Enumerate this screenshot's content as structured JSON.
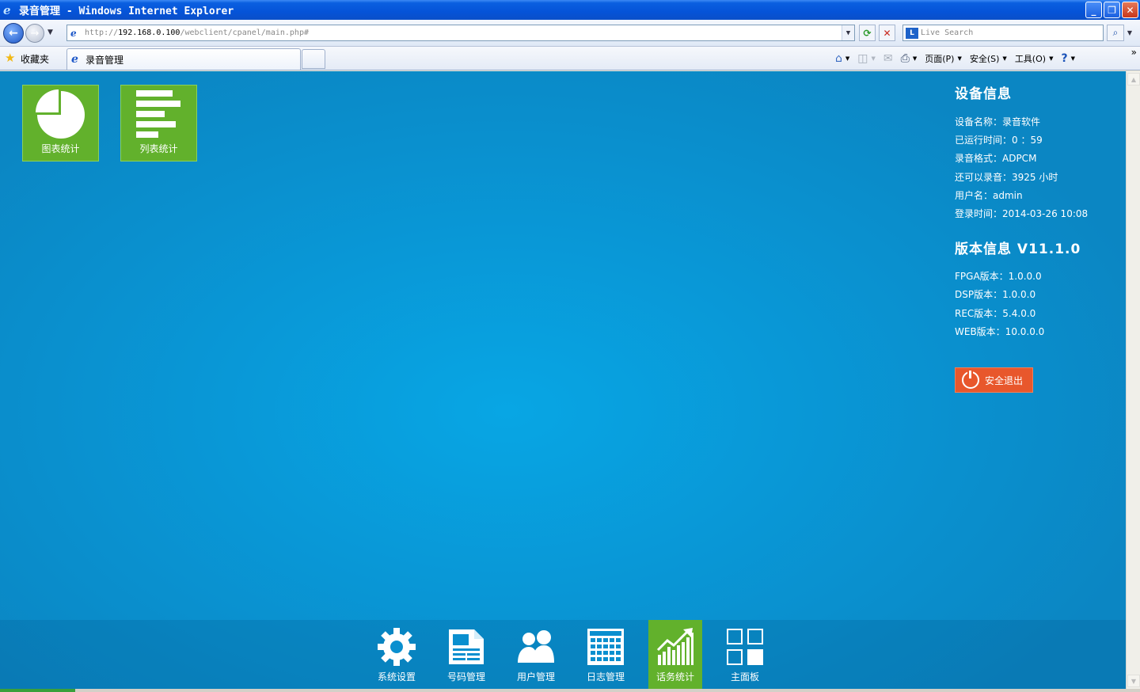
{
  "window": {
    "title": "录音管理 - Windows Internet Explorer",
    "address": {
      "prefix": "http://",
      "host": "192.168.0.100",
      "path": "/webclient/cpanel/main.php#"
    },
    "search_placeholder": "Live Search"
  },
  "favorites_label": "收藏夹",
  "tab": {
    "label": "录音管理"
  },
  "command_bar": {
    "page": "页面(P)",
    "safety": "安全(S)",
    "tools": "工具(O)"
  },
  "tiles": [
    {
      "label": "图表统计",
      "icon": "pie-chart-icon"
    },
    {
      "label": "列表统计",
      "icon": "bar-list-icon"
    }
  ],
  "device_info": {
    "heading": "设备信息",
    "rows": [
      "设备名称：录音软件",
      "已运行时间：0 ：59",
      "录音格式：ADPCM",
      "还可以录音：3925 小时",
      "用户名：admin",
      "登录时间：2014-03-26 10:08"
    ]
  },
  "version_info": {
    "heading": "版本信息 V11.1.0",
    "rows": [
      "FPGA版本：1.0.0.0",
      "DSP版本：1.0.0.0",
      "REC版本：5.4.0.0",
      "WEB版本：10.0.0.0"
    ]
  },
  "logout_label": "安全退出",
  "dock": [
    {
      "label": "系统设置",
      "icon": "gear-icon",
      "active": false
    },
    {
      "label": "号码管理",
      "icon": "document-icon",
      "active": false
    },
    {
      "label": "用户管理",
      "icon": "users-icon",
      "active": false
    },
    {
      "label": "日志管理",
      "icon": "calendar-icon",
      "active": false
    },
    {
      "label": "话务统计",
      "icon": "growth-chart-icon",
      "active": true
    },
    {
      "label": "主面板",
      "icon": "grid-icon",
      "active": false
    }
  ],
  "colors": {
    "tile_green": "#62b12c",
    "logout_orange": "#e8572c",
    "background_blue": "#0997d6"
  }
}
